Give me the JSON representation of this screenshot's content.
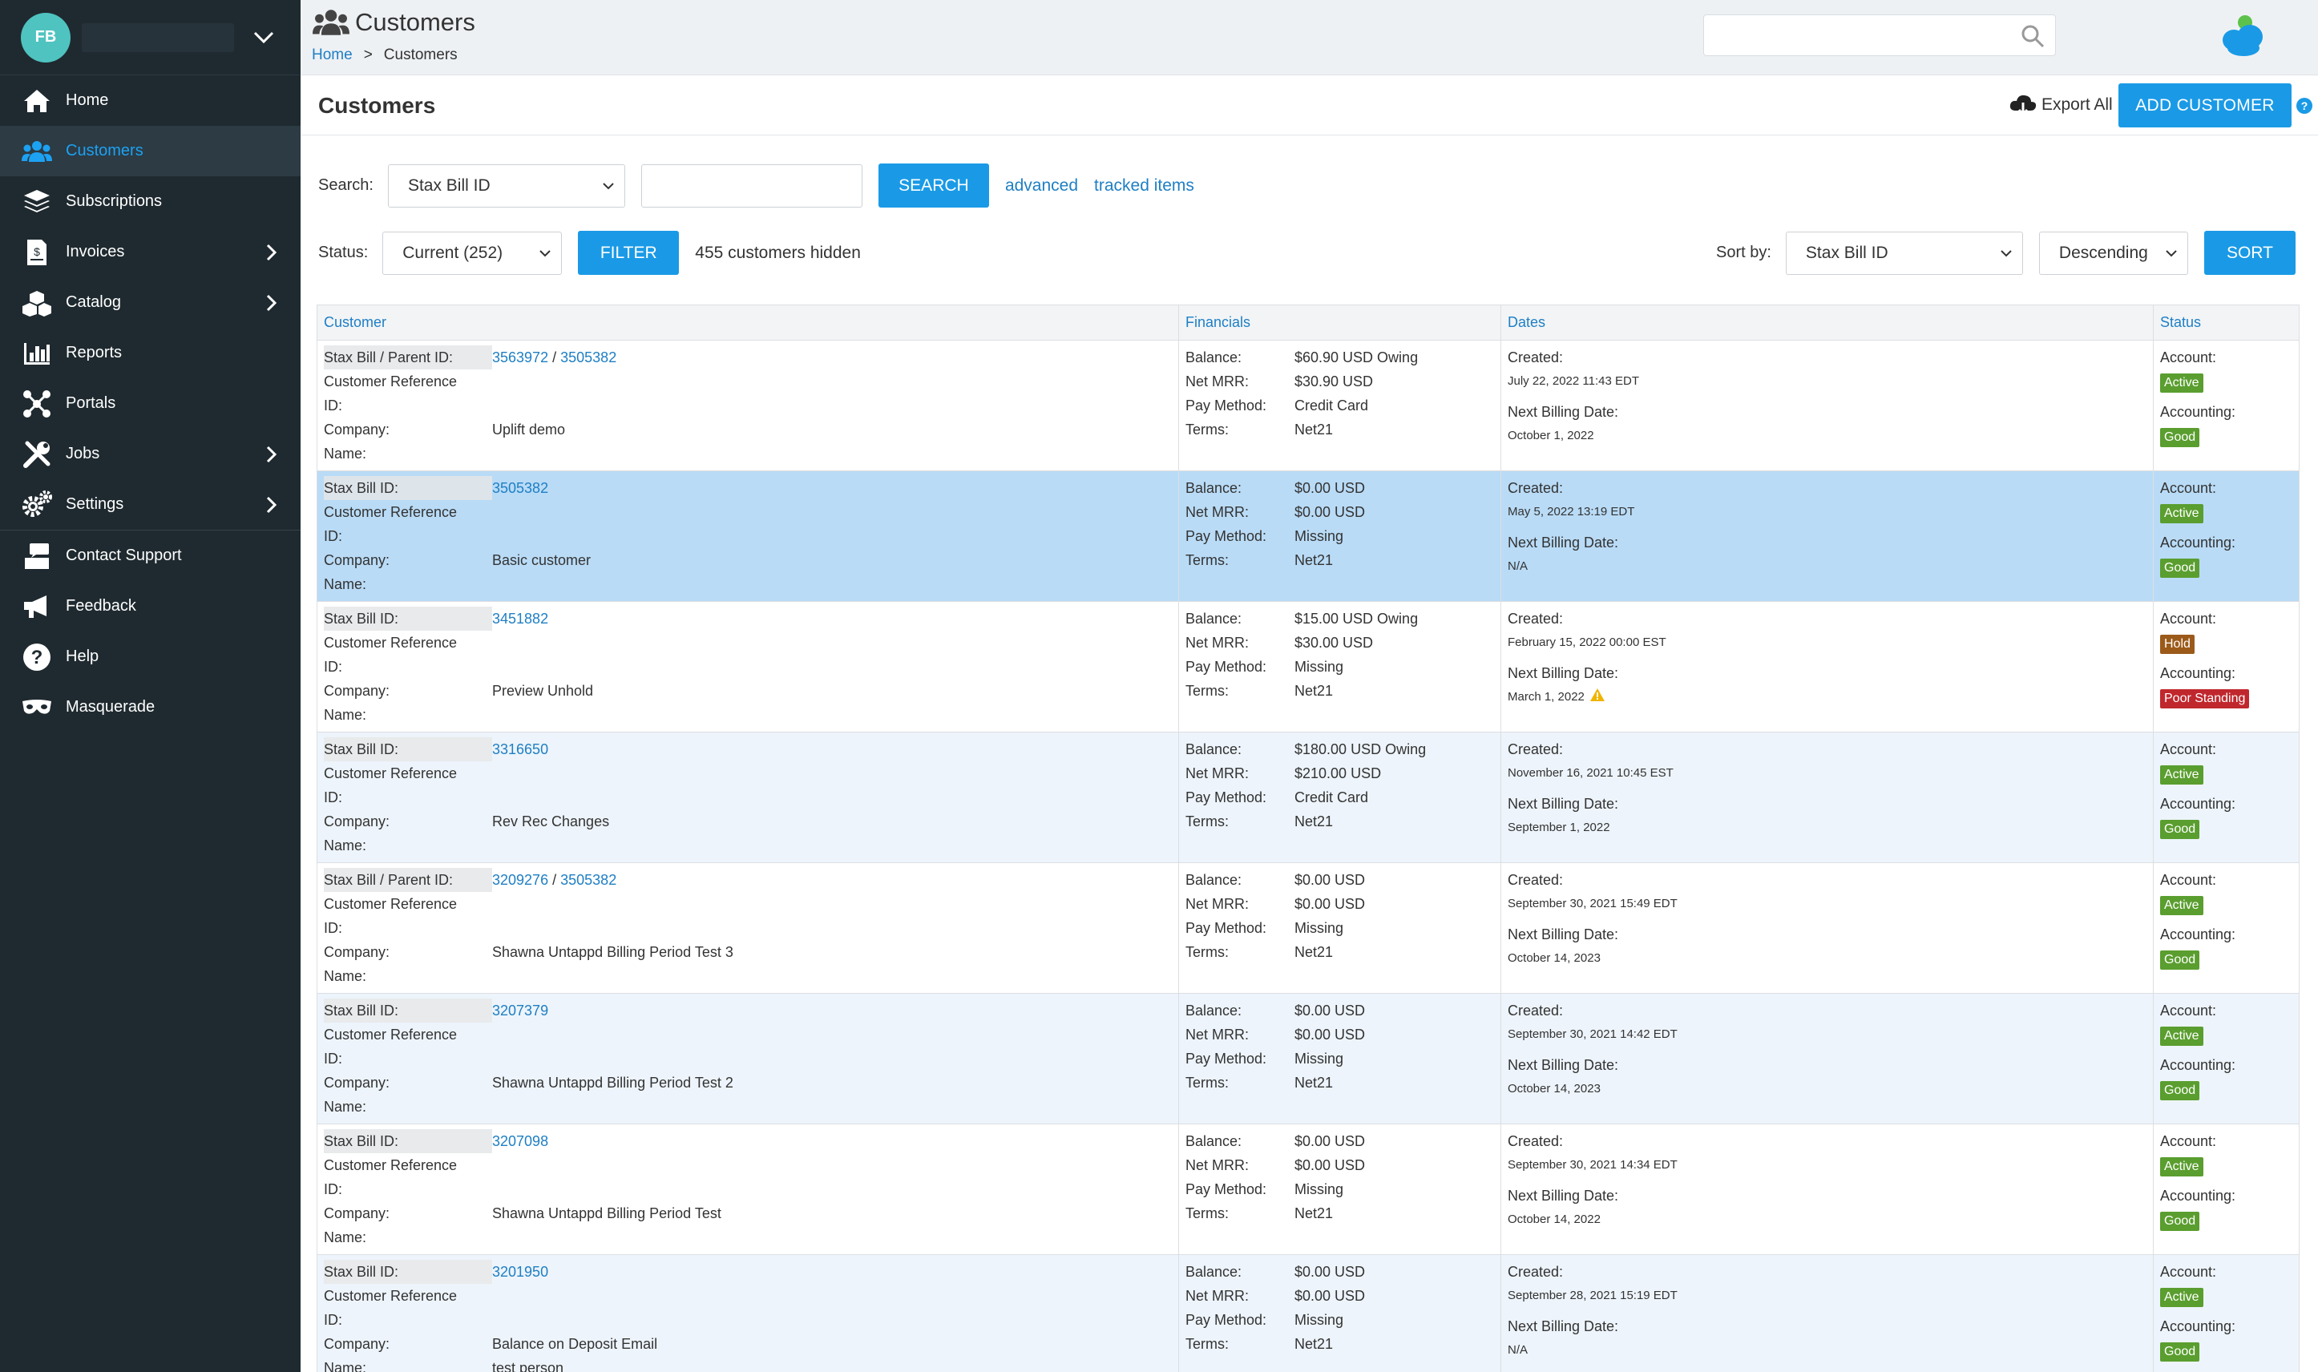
{
  "sidebar": {
    "avatar_initials": "FB",
    "items": [
      {
        "label": "Home",
        "icon": "home-icon"
      },
      {
        "label": "Customers",
        "icon": "users-icon"
      },
      {
        "label": "Subscriptions",
        "icon": "layers-icon"
      },
      {
        "label": "Invoices",
        "icon": "invoice-icon"
      },
      {
        "label": "Catalog",
        "icon": "cubes-icon"
      },
      {
        "label": "Reports",
        "icon": "bar-chart-icon"
      },
      {
        "label": "Portals",
        "icon": "network-icon"
      },
      {
        "label": "Jobs",
        "icon": "tools-icon"
      },
      {
        "label": "Settings",
        "icon": "gears-icon"
      },
      {
        "label": "Contact Support",
        "icon": "support-icon"
      },
      {
        "label": "Feedback",
        "icon": "megaphone-icon"
      },
      {
        "label": "Help",
        "icon": "question-circle-icon"
      },
      {
        "label": "Masquerade",
        "icon": "mask-icon"
      }
    ]
  },
  "header": {
    "title": "Customers",
    "breadcrumb": {
      "home": "Home",
      "separator": ">",
      "current": "Customers"
    },
    "search_placeholder": ""
  },
  "main": {
    "section_title": "Customers",
    "export_label": "Export All",
    "add_label": "ADD CUSTOMER",
    "help_label": "?",
    "search": {
      "label": "Search:",
      "field_value": "Stax Bill ID",
      "input_value": "",
      "button": "SEARCH",
      "advanced": "advanced",
      "tracked": "tracked items"
    },
    "status": {
      "label": "Status:",
      "value": "Current (252)",
      "button": "FILTER",
      "hidden_text": "455 customers hidden"
    },
    "sort": {
      "label": "Sort by:",
      "field": "Stax Bill ID",
      "order": "Descending",
      "button": "SORT"
    }
  },
  "table": {
    "headers": {
      "customer": "Customer",
      "financials": "Financials",
      "dates": "Dates",
      "status": "Status"
    },
    "labels": {
      "ref": "Customer Reference",
      "id": "ID:",
      "company": "Company:",
      "name": "Name:",
      "balance": "Balance:",
      "mrr": "Net MRR:",
      "pay": "Pay Method:",
      "terms": "Terms:",
      "created": "Created:",
      "next": "Next Billing Date:",
      "account": "Account:",
      "accounting": "Accounting:"
    },
    "rows": [
      {
        "id_label": "Stax Bill / Parent ID:",
        "id": "3563972",
        "parent_sep": "/",
        "parent": "3505382",
        "company": "Uplift demo",
        "name": "",
        "balance": "$60.90 USD Owing",
        "mrr": "$30.90 USD",
        "pay": "Credit Card",
        "terms": "Net21",
        "created": "July 22, 2022 11:43 EDT",
        "next": "October 1, 2022",
        "account": "Active",
        "accounting": "Good"
      },
      {
        "id_label": "Stax Bill ID:",
        "id": "3505382",
        "company": "Basic customer",
        "name": "",
        "balance": "$0.00 USD",
        "mrr": "$0.00 USD",
        "pay": "Missing",
        "terms": "Net21",
        "created": "May 5, 2022 13:19 EDT",
        "next": "N/A",
        "account": "Active",
        "accounting": "Good"
      },
      {
        "id_label": "Stax Bill ID:",
        "id": "3451882",
        "company": "Preview Unhold",
        "name": "",
        "balance": "$15.00 USD Owing",
        "mrr": "$30.00 USD",
        "pay": "Missing",
        "terms": "Net21",
        "created": "February 15, 2022 00:00 EST",
        "next": "March 1, 2022",
        "account": "Hold",
        "accounting": "Poor Standing"
      },
      {
        "id_label": "Stax Bill ID:",
        "id": "3316650",
        "company": "Rev Rec Changes",
        "name": "",
        "balance": "$180.00 USD Owing",
        "mrr": "$210.00 USD",
        "pay": "Credit Card",
        "terms": "Net21",
        "created": "November 16, 2021 10:45 EST",
        "next": "September 1, 2022",
        "account": "Active",
        "accounting": "Good"
      },
      {
        "id_label": "Stax Bill / Parent ID:",
        "id": "3209276",
        "parent_sep": "/",
        "parent": "3505382",
        "company": "Shawna Untappd Billing Period Test 3",
        "name": "",
        "balance": "$0.00 USD",
        "mrr": "$0.00 USD",
        "pay": "Missing",
        "terms": "Net21",
        "created": "September 30, 2021 15:49 EDT",
        "next": "October 14, 2023",
        "account": "Active",
        "accounting": "Good"
      },
      {
        "id_label": "Stax Bill ID:",
        "id": "3207379",
        "company": "Shawna Untappd Billing Period Test 2",
        "name": "",
        "balance": "$0.00 USD",
        "mrr": "$0.00 USD",
        "pay": "Missing",
        "terms": "Net21",
        "created": "September 30, 2021 14:42 EDT",
        "next": "October 14, 2023",
        "account": "Active",
        "accounting": "Good"
      },
      {
        "id_label": "Stax Bill ID:",
        "id": "3207098",
        "company": "Shawna Untappd Billing Period Test",
        "name": "",
        "balance": "$0.00 USD",
        "mrr": "$0.00 USD",
        "pay": "Missing",
        "terms": "Net21",
        "created": "September 30, 2021 14:34 EDT",
        "next": "October 14, 2022",
        "account": "Active",
        "accounting": "Good"
      },
      {
        "id_label": "Stax Bill ID:",
        "id": "3201950",
        "company": "Balance on Deposit Email",
        "name": "test person",
        "balance": "$0.00 USD",
        "mrr": "$0.00 USD",
        "pay": "Missing",
        "terms": "Net21",
        "created": "September 28, 2021 15:19 EDT",
        "next": "N/A",
        "account": "Active",
        "accounting": "Good"
      }
    ]
  },
  "colors": {
    "sidebar_bg": "#1f2a30",
    "accent": "#1a9ae6",
    "link": "#1e7fc4",
    "selected_row": "#b9dbf6",
    "alt_row": "#edf4fb",
    "badge_good": "#5a9e2f",
    "badge_hold": "#9c5a1a",
    "badge_poor": "#c0272d"
  }
}
